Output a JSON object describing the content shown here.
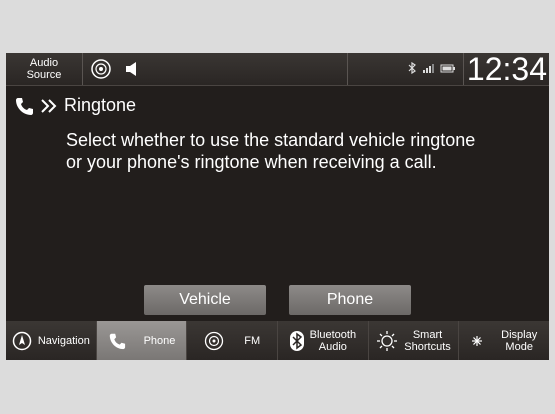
{
  "status_bar": {
    "audio_source_line1": "Audio",
    "audio_source_line2": "Source",
    "time": "12:34",
    "icons": [
      "audio-source-icon",
      "speaker-icon",
      "bluetooth-icon",
      "signal-icon",
      "battery-icon"
    ]
  },
  "header": {
    "title": "Ringtone",
    "icons": [
      "phone-icon",
      "double-chevron-icon"
    ]
  },
  "message": {
    "line1": "Select whether to use the standard vehicle ringtone",
    "line2": "or your phone's ringtone when receiving a call."
  },
  "buttons": {
    "vehicle": "Vehicle",
    "phone": "Phone"
  },
  "nav": {
    "items": [
      {
        "label": "Navigation",
        "icon": "compass-icon"
      },
      {
        "label": "Phone",
        "icon": "phone-icon",
        "active": true
      },
      {
        "label": "FM",
        "icon": "radio-icon"
      },
      {
        "label_line1": "Bluetooth",
        "label_line2": "Audio",
        "icon": "bluetooth-icon"
      },
      {
        "label_line1": "Smart",
        "label_line2": "Shortcuts",
        "icon": "shortcuts-icon"
      },
      {
        "label_line1": "Display",
        "label_line2": "Mode",
        "icon": "display-mode-icon"
      }
    ]
  },
  "colors": {
    "screen_bg": "#221e1c",
    "button_bg": "#7c7977",
    "active_tab": "#8a8785"
  }
}
